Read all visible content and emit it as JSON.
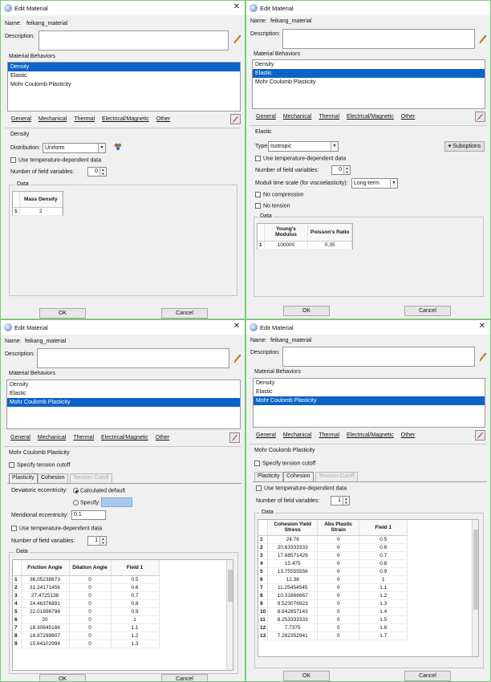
{
  "common": {
    "title": "Edit Material",
    "name_label": "Name:",
    "name_value": "feikang_material",
    "description_label": "Description:",
    "behaviors_label": "Material Behaviors",
    "behaviors": [
      "Density",
      "Elastic",
      "Mohr Coulomb Plasticity"
    ],
    "menus": [
      "General",
      "Mechanical",
      "Thermal",
      "Electrical/Magnetic",
      "Other"
    ],
    "ok": "OK",
    "cancel": "Cancel",
    "close": "✕",
    "use_temp": "Use temperature-dependent data",
    "num_field": "Number of field variables:",
    "data_label": "Data"
  },
  "p1": {
    "section": "Density",
    "distribution_label": "Distribution:",
    "distribution": "Uniform",
    "num_field_value": "0",
    "col": "Mass Density",
    "rows": [
      [
        "1",
        "2"
      ]
    ]
  },
  "p2": {
    "section": "Elastic",
    "type_label": "Type:",
    "type": "Isotropic",
    "suboptions": "Suboptions",
    "num_field_value": "0",
    "moduli_label": "Moduli time scale (for viscoelasticity):",
    "moduli": "Long-term",
    "no_compression": "No compression",
    "no_tension": "No tension",
    "cols": [
      "Young's Modulus",
      "Poisson's Ratio"
    ],
    "rows": [
      [
        "1",
        "100000",
        "0.35"
      ]
    ]
  },
  "p3": {
    "section": "Mohr Coulomb Plasticity",
    "specify_tension": "Specify tension cutoff",
    "tabs": [
      "Plasticity",
      "Cohesion",
      "Tension Cutoff"
    ],
    "dev_label": "Deviatoric eccentricity:",
    "calc_default": "Calculated default",
    "specify": "Specify:",
    "merid_label": "Meridional eccentricity:",
    "merid_value": "0.1",
    "num_field_value": "1",
    "cols": [
      "Friction Angle",
      "Dilation Angle",
      "Field 1"
    ],
    "rows": [
      [
        "1",
        "36.05238873",
        "0",
        "0.5"
      ],
      [
        "2",
        "31.24171456",
        "0",
        "0.6"
      ],
      [
        "3",
        "27.4725138",
        "0",
        "0.7"
      ],
      [
        "4",
        "24.46376891",
        "0",
        "0.8"
      ],
      [
        "5",
        "22.01896798",
        "0",
        "0.9"
      ],
      [
        "6",
        "20",
        "0",
        "1"
      ],
      [
        "7",
        "18.30845166",
        "0",
        "1.1"
      ],
      [
        "8",
        "16.87299807",
        "0",
        "1.2"
      ],
      [
        "9",
        "15.64102994",
        "0",
        "1.3"
      ]
    ]
  },
  "p4": {
    "section": "Mohr Coulomb Plasticity",
    "specify_tension": "Specify tension cutoff",
    "tabs": [
      "Plasticity",
      "Cohesion",
      "Tension Cutoff"
    ],
    "num_field_value": "1",
    "cols": [
      "Cohesion Yield Stress",
      "Abs Plastic Strain",
      "Field 1"
    ],
    "rows": [
      [
        "1",
        "24.76",
        "0",
        "0.5"
      ],
      [
        "2",
        "20.63333333",
        "0",
        "0.6"
      ],
      [
        "3",
        "17.68571429",
        "0",
        "0.7"
      ],
      [
        "4",
        "15.475",
        "0",
        "0.8"
      ],
      [
        "5",
        "13.75555556",
        "0",
        "0.9"
      ],
      [
        "6",
        "12.38",
        "0",
        "1"
      ],
      [
        "7",
        "11.25454545",
        "0",
        "1.1"
      ],
      [
        "8",
        "10.31666667",
        "0",
        "1.2"
      ],
      [
        "9",
        "9.523076923",
        "0",
        "1.3"
      ],
      [
        "10",
        "8.842857143",
        "0",
        "1.4"
      ],
      [
        "11",
        "8.253333333",
        "0",
        "1.5"
      ],
      [
        "12",
        "7.7375",
        "0",
        "1.6"
      ],
      [
        "13",
        "7.282352941",
        "0",
        "1.7"
      ]
    ]
  }
}
